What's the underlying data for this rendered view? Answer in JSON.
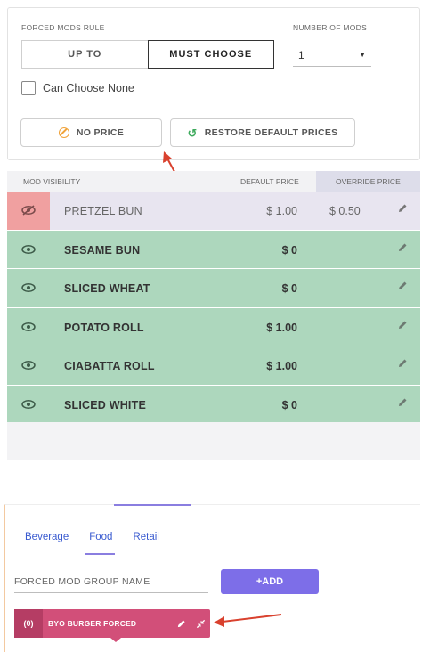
{
  "forced_mods_rule": {
    "label": "FORCED MODS RULE",
    "options": [
      "UP TO",
      "MUST CHOOSE"
    ],
    "selected": "MUST CHOOSE"
  },
  "number_of_mods": {
    "label": "NUMBER OF MODS",
    "value": "1"
  },
  "can_choose_none": {
    "label": "Can Choose None",
    "checked": false
  },
  "actions": {
    "no_price": "NO PRICE",
    "restore": "RESTORE DEFAULT PRICES"
  },
  "table": {
    "headers": {
      "visibility": "MOD VISIBILITY",
      "default_price": "DEFAULT PRICE",
      "override_price": "OVERRIDE PRICE"
    },
    "rows": [
      {
        "name": "PRETZEL BUN",
        "default_price": "$ 1.00",
        "override_price": "$ 0.50",
        "visible": false
      },
      {
        "name": "SESAME BUN",
        "default_price": "$ 0",
        "override_price": "",
        "visible": true
      },
      {
        "name": "SLICED WHEAT",
        "default_price": "$ 0",
        "override_price": "",
        "visible": true
      },
      {
        "name": "POTATO ROLL",
        "default_price": "$ 1.00",
        "override_price": "",
        "visible": true
      },
      {
        "name": "CIABATTA ROLL",
        "default_price": "$ 1.00",
        "override_price": "",
        "visible": true
      },
      {
        "name": "SLICED WHITE",
        "default_price": "$ 0",
        "override_price": "",
        "visible": true
      }
    ]
  },
  "tabs": {
    "items": [
      "Beverage",
      "Food",
      "Retail"
    ],
    "active": "Food"
  },
  "group_form": {
    "placeholder": "FORCED MOD GROUP NAME",
    "add_label": "+ADD"
  },
  "group_chip": {
    "count": "(0)",
    "name": "BYO BURGER FORCED"
  },
  "colors": {
    "accent": "#7d6ee8",
    "visible_row": "#add7bd",
    "hidden_eye": "#f0a0a0",
    "chip": "#d24f79",
    "arrow": "#d9412e"
  }
}
